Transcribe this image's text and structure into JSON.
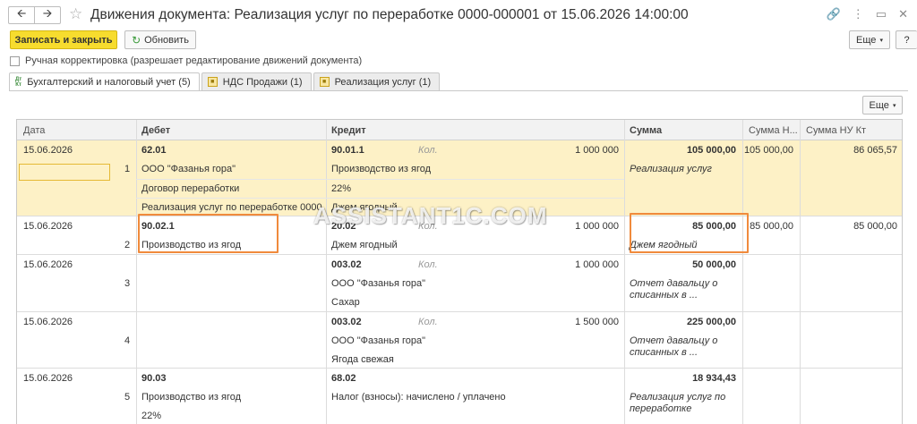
{
  "window": {
    "title": "Движения документа: Реализация услуг по переработке 0000-000001 от 15.06.2026 14:00:00"
  },
  "toolbar": {
    "save_close": "Записать и закрыть",
    "refresh": "Обновить",
    "more": "Еще"
  },
  "manual_edit": {
    "label": "Ручная корректировка (разрешает редактирование движений документа)",
    "checked": false
  },
  "tabs": [
    {
      "label": "Бухгалтерский и налоговый учет (5)",
      "active": true
    },
    {
      "label": "НДС Продажи (1)",
      "active": false
    },
    {
      "label": "Реализация услуг (1)",
      "active": false
    }
  ],
  "table": {
    "more": "Еще",
    "headers": {
      "date": "Дата",
      "debit": "Дебет",
      "credit": "Кредит",
      "sum": "Сумма",
      "sum_nu_dt": "Сумма Н...",
      "sum_nu_kt": "Сумма НУ Кт"
    },
    "rows": [
      {
        "date": "15.06.2026",
        "num": "1",
        "debit_account": "62.01",
        "debit_sub": [
          "ООО \"Фазанья гора\"",
          "Договор переработки",
          "Реализация услуг по переработке 0000..."
        ],
        "credit_account": "90.01.1",
        "qty_label": "Кол.",
        "qty": "1 000 000",
        "credit_sub": [
          "Производство из ягод",
          "22%",
          "Джем ягодный"
        ],
        "sum": "105 000,00",
        "content": "Реализация услуг",
        "sum_nu_dt": "105 000,00",
        "sum_nu_kt": "86 065,57"
      },
      {
        "date": "15.06.2026",
        "num": "2",
        "debit_account": "90.02.1",
        "debit_sub": [
          "Производство из ягод"
        ],
        "credit_account": "20.02",
        "qty_label": "Кол.",
        "qty": "1 000 000",
        "credit_sub": [
          "Джем ягодный"
        ],
        "sum": "85 000,00",
        "content": "Джем ягодный",
        "sum_nu_dt": "85 000,00",
        "sum_nu_kt": "85 000,00"
      },
      {
        "date": "15.06.2026",
        "num": "3",
        "debit_account": "",
        "credit_account": "003.02",
        "qty_label": "Кол.",
        "qty": "1 000 000",
        "credit_sub": [
          "ООО \"Фазанья гора\"",
          "Сахар"
        ],
        "sum": "50 000,00",
        "content": "Отчет давальцу о списанных в ..."
      },
      {
        "date": "15.06.2026",
        "num": "4",
        "debit_account": "",
        "credit_account": "003.02",
        "qty_label": "Кол.",
        "qty": "1 500 000",
        "credit_sub": [
          "ООО \"Фазанья гора\"",
          "Ягода свежая"
        ],
        "sum": "225 000,00",
        "content": "Отчет давальцу о списанных в ..."
      },
      {
        "date": "15.06.2026",
        "num": "5",
        "debit_account": "90.03",
        "debit_sub": [
          "Производство из ягод",
          "22%"
        ],
        "credit_account": "68.02",
        "credit_sub": [
          "Налог (взносы): начислено / уплачено"
        ],
        "sum": "18 934,43",
        "content": "Реализация услуг по переработке"
      }
    ]
  },
  "watermark": "ASSISTANT1C.COM",
  "colors": {
    "accent": "#f7dc2e",
    "selected_row": "#fdf1c6",
    "highlight": "#f08a3c"
  }
}
